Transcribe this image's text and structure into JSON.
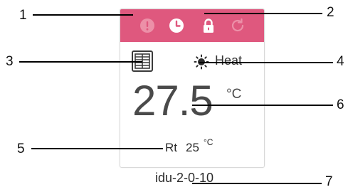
{
  "callouts": {
    "c1": "1",
    "c2": "2",
    "c3": "3",
    "c4": "4",
    "c5": "5",
    "c6": "6",
    "c7": "7"
  },
  "card": {
    "header_color": "#df587e",
    "icons": {
      "fault": "fault-alert-icon",
      "timer": "clock-icon",
      "lock": "lock-icon",
      "refresh": "refresh-icon"
    },
    "unit_icon": "indoor-unit-icon",
    "mode": {
      "icon": "sun-icon",
      "label": "Heat"
    },
    "set_temp": {
      "value": "27.5",
      "unit": "°C"
    },
    "room_temp": {
      "label": "Rt",
      "value": "25",
      "unit": "°C"
    },
    "device_id": "idu-2-0-10"
  }
}
